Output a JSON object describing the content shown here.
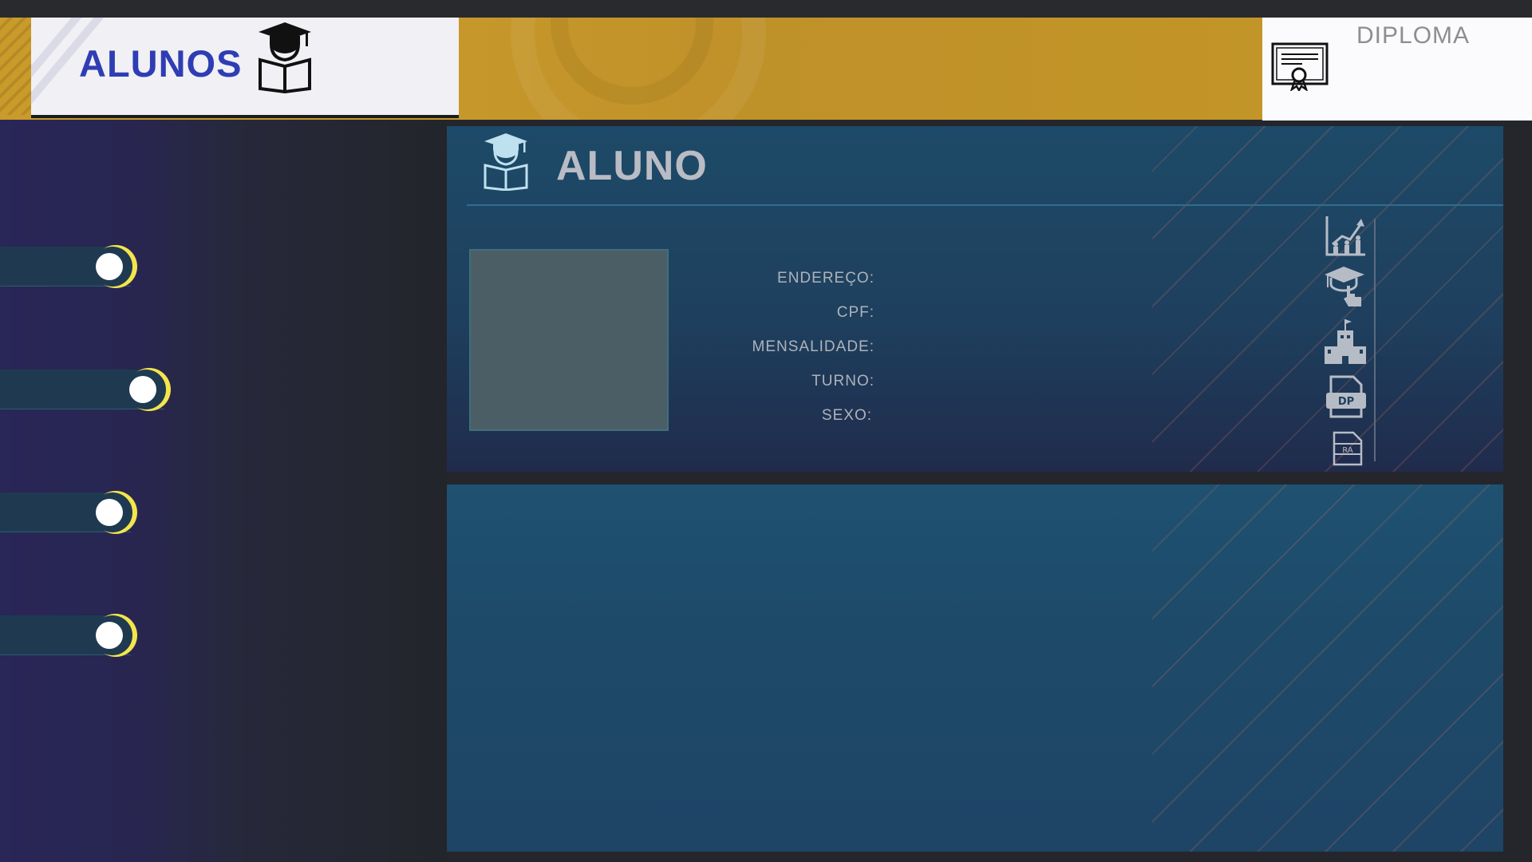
{
  "header": {
    "title": "ALUNOS",
    "diploma_label": "DIPLOMA"
  },
  "panel": {
    "title": "ALUNO",
    "fields": [
      {
        "label": "ENDEREÇO:"
      },
      {
        "label": "CPF:"
      },
      {
        "label": "MENSALIDADE:"
      },
      {
        "label": "TURNO:"
      },
      {
        "label": "SEXO:"
      }
    ],
    "actions": [
      {
        "icon": "growth-chart-icon"
      },
      {
        "icon": "graduation-click-icon"
      },
      {
        "icon": "school-building-icon"
      },
      {
        "icon": "dp-document-icon",
        "text": "DP"
      },
      {
        "icon": "ra-document-icon",
        "text": "RA"
      }
    ]
  },
  "sidebar": {
    "toggles": [
      {
        "name": "toggle-1",
        "state": "on"
      },
      {
        "name": "toggle-2",
        "state": "on"
      },
      {
        "name": "toggle-3",
        "state": "on"
      },
      {
        "name": "toggle-4",
        "state": "on"
      }
    ]
  },
  "colors": {
    "accent_gold": "#c99b2b",
    "title_blue": "#2f3db4",
    "knob_ring": "#f4e54c",
    "panel_blue": "#1e4a69"
  }
}
